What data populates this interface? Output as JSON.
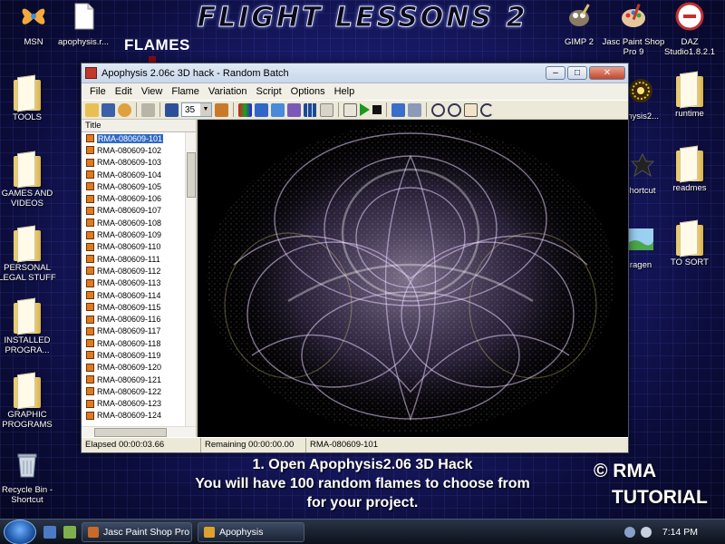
{
  "banner": "FLIGHT LESSONS 2",
  "callout": "FLAMES",
  "desktop_icons": {
    "msn": "MSN",
    "apophysis": "apophysis.r...",
    "gimp": "GIMP 2",
    "paintshop": "Jasc Paint Shop Pro 9",
    "daz": "DAZ Studio1.8.2.1",
    "tools": "TOOLS",
    "games": "GAMES AND VIDEOS",
    "personal": "PERSONAL LEGAL STUFF",
    "installed": "INSTALLED PROGRA...",
    "graphic": "GRAPHIC PROGRAMS",
    "recycle": "Recycle Bin - Shortcut",
    "aphysis2": "physis2...",
    "runtime": "runtime",
    "shortcut": "hortcut",
    "readmes": "readmes",
    "ragen": "ragen",
    "tosort": "TO SORT"
  },
  "window": {
    "title": "Apophysis 2.06c 3D hack - Random Batch",
    "menu": [
      "File",
      "Edit",
      "View",
      "Flame",
      "Variation",
      "Script",
      "Options",
      "Help"
    ],
    "combo_value": "35",
    "list_header": "Title",
    "flames": [
      "RMA-080609-101",
      "RMA-080609-102",
      "RMA-080609-103",
      "RMA-080609-104",
      "RMA-080609-105",
      "RMA-080609-106",
      "RMA-080609-107",
      "RMA-080609-108",
      "RMA-080609-109",
      "RMA-080609-110",
      "RMA-080609-111",
      "RMA-080609-112",
      "RMA-080609-113",
      "RMA-080609-114",
      "RMA-080609-115",
      "RMA-080609-116",
      "RMA-080609-117",
      "RMA-080609-118",
      "RMA-080609-119",
      "RMA-080609-120",
      "RMA-080609-121",
      "RMA-080609-122",
      "RMA-080609-123",
      "RMA-080609-124"
    ],
    "selected_index": 0,
    "status": {
      "elapsed": "Elapsed 00:00:03.66",
      "remaining": "Remaining 00:00:00.00",
      "current": "RMA-080609-101"
    }
  },
  "caption": {
    "line1": "1. Open Apophysis2.06 3D Hack",
    "line2": "You will have 100 random flames to choose from",
    "line3": "for your project."
  },
  "credit": {
    "line1": "© RMA",
    "line2": "TUTORIAL"
  },
  "taskbar": {
    "tasks": [
      "Jasc Paint Shop Pro",
      "Apophysis"
    ],
    "clock": "7:14 PM"
  },
  "colors": {
    "selection": "#316ac5",
    "arrow": "#8a0d0d",
    "flame": "#c9a0ff"
  }
}
